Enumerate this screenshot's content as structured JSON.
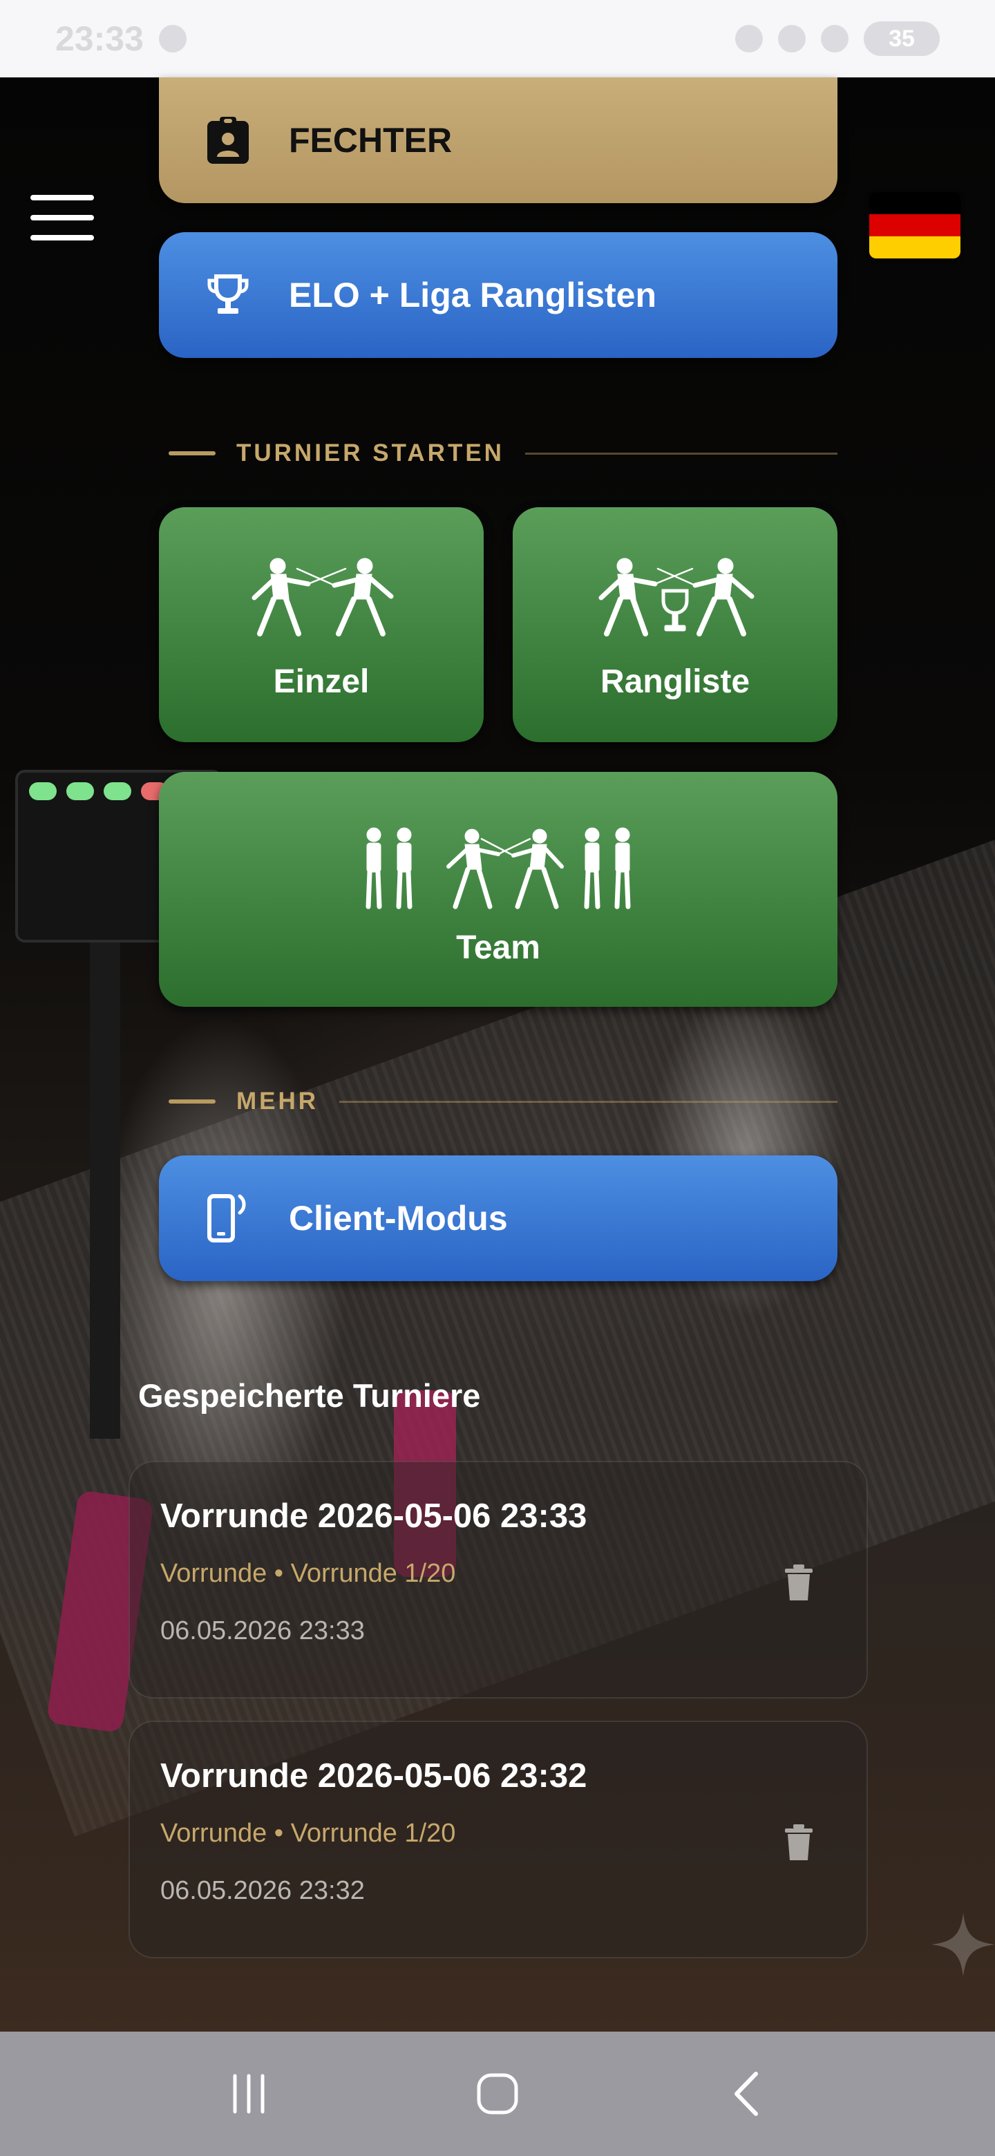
{
  "status_bar": {
    "time": "23:33",
    "battery": "35"
  },
  "menu": {
    "icon": "hamburger-menu-icon"
  },
  "language": {
    "icon": "flag-germany-icon",
    "colors": [
      "#000000",
      "#dd0000",
      "#ffce00"
    ]
  },
  "buttons": {
    "fechter": {
      "label": "FECHTER",
      "icon": "clipboard-person-icon"
    },
    "elo": {
      "label": "ELO + Liga Ranglisten",
      "icon": "trophy-icon"
    },
    "client": {
      "label": "Client-Modus",
      "icon": "phone-signal-icon"
    }
  },
  "sections": {
    "turnier": "TURNIER STARTEN",
    "mehr": "MEHR"
  },
  "tiles": {
    "einzel": {
      "label": "Einzel",
      "icon": "two-fencers-icon"
    },
    "rangliste": {
      "label": "Rangliste",
      "icon": "fencers-trophy-icon"
    },
    "team": {
      "label": "Team",
      "icon": "fencing-team-icon"
    }
  },
  "saved": {
    "title": "Gespeicherte Turniere",
    "items": [
      {
        "title": "Vorrunde 2026-05-06 23:33",
        "subtitle": "Vorrunde • Vorrunde 1/20",
        "date": "06.05.2026 23:33"
      },
      {
        "title": "Vorrunde 2026-05-06 23:32",
        "subtitle": "Vorrunde • Vorrunde 1/20",
        "date": "06.05.2026 23:32"
      }
    ]
  },
  "colors": {
    "gold": "#b89b61",
    "blue": "#2f6cc8",
    "green": "#3f8440"
  }
}
